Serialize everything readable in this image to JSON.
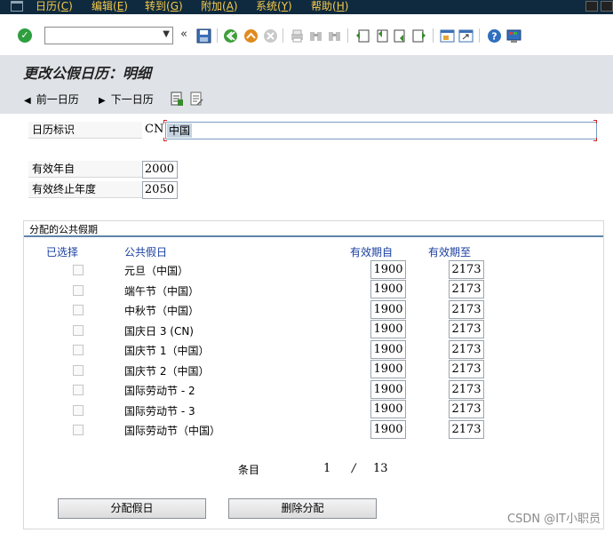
{
  "menubar": {
    "items": [
      "日历(C)",
      "编辑(E)",
      "转到(G)",
      "附加(A)",
      "系统(Y)",
      "帮助(H)"
    ],
    "bg_color": "#0f2a3e",
    "text_color": "#f7c94a"
  },
  "toolbar": {
    "icons": [
      "check-icon",
      "back-icon",
      "exit-icon",
      "cancel-icon",
      "print-icon",
      "find-icon",
      "find-next-icon",
      "first-page-icon",
      "prev-page-icon",
      "next-page-icon",
      "last-page-icon",
      "new-session-icon",
      "shortcut-icon",
      "help-icon",
      "customize-icon"
    ]
  },
  "page": {
    "title": "更改公假日历：明细"
  },
  "app_toolbar": {
    "prev_label": "前一日历",
    "next_label": "下一日历"
  },
  "header": {
    "calendar_id_label": "日历标识",
    "calendar_id_code": "CN",
    "calendar_id_value": "中国",
    "valid_from_label": "有效年自",
    "valid_from_value": "2000",
    "valid_to_label": "有效终止年度",
    "valid_to_value": "2050"
  },
  "holidays": {
    "group_title": "分配的公共假期",
    "columns": {
      "selected": "已选择",
      "holiday": "公共假日",
      "from": "有效期自",
      "to": "有效期至"
    },
    "rows": [
      {
        "name": "元旦（中国）",
        "from": "1900",
        "to": "2173"
      },
      {
        "name": "端午节（中国）",
        "from": "1900",
        "to": "2173"
      },
      {
        "name": "中秋节（中国）",
        "from": "1900",
        "to": "2173"
      },
      {
        "name": "国庆日 3 (CN)",
        "from": "1900",
        "to": "2173"
      },
      {
        "name": "国庆节 1（中国）",
        "from": "1900",
        "to": "2173"
      },
      {
        "name": "国庆节 2（中国）",
        "from": "1900",
        "to": "2173"
      },
      {
        "name": "国际劳动节 - 2",
        "from": "1900",
        "to": "2173"
      },
      {
        "name": "国际劳动节 - 3",
        "from": "1900",
        "to": "2173"
      },
      {
        "name": "国际劳动节（中国）",
        "from": "1900",
        "to": "2173"
      }
    ],
    "pager": {
      "label": "条目",
      "current": "1",
      "separator": "/",
      "total": "13"
    },
    "assign_button": "分配假日",
    "delete_button": "删除分配"
  },
  "watermark": "CSDN @IT小职员"
}
